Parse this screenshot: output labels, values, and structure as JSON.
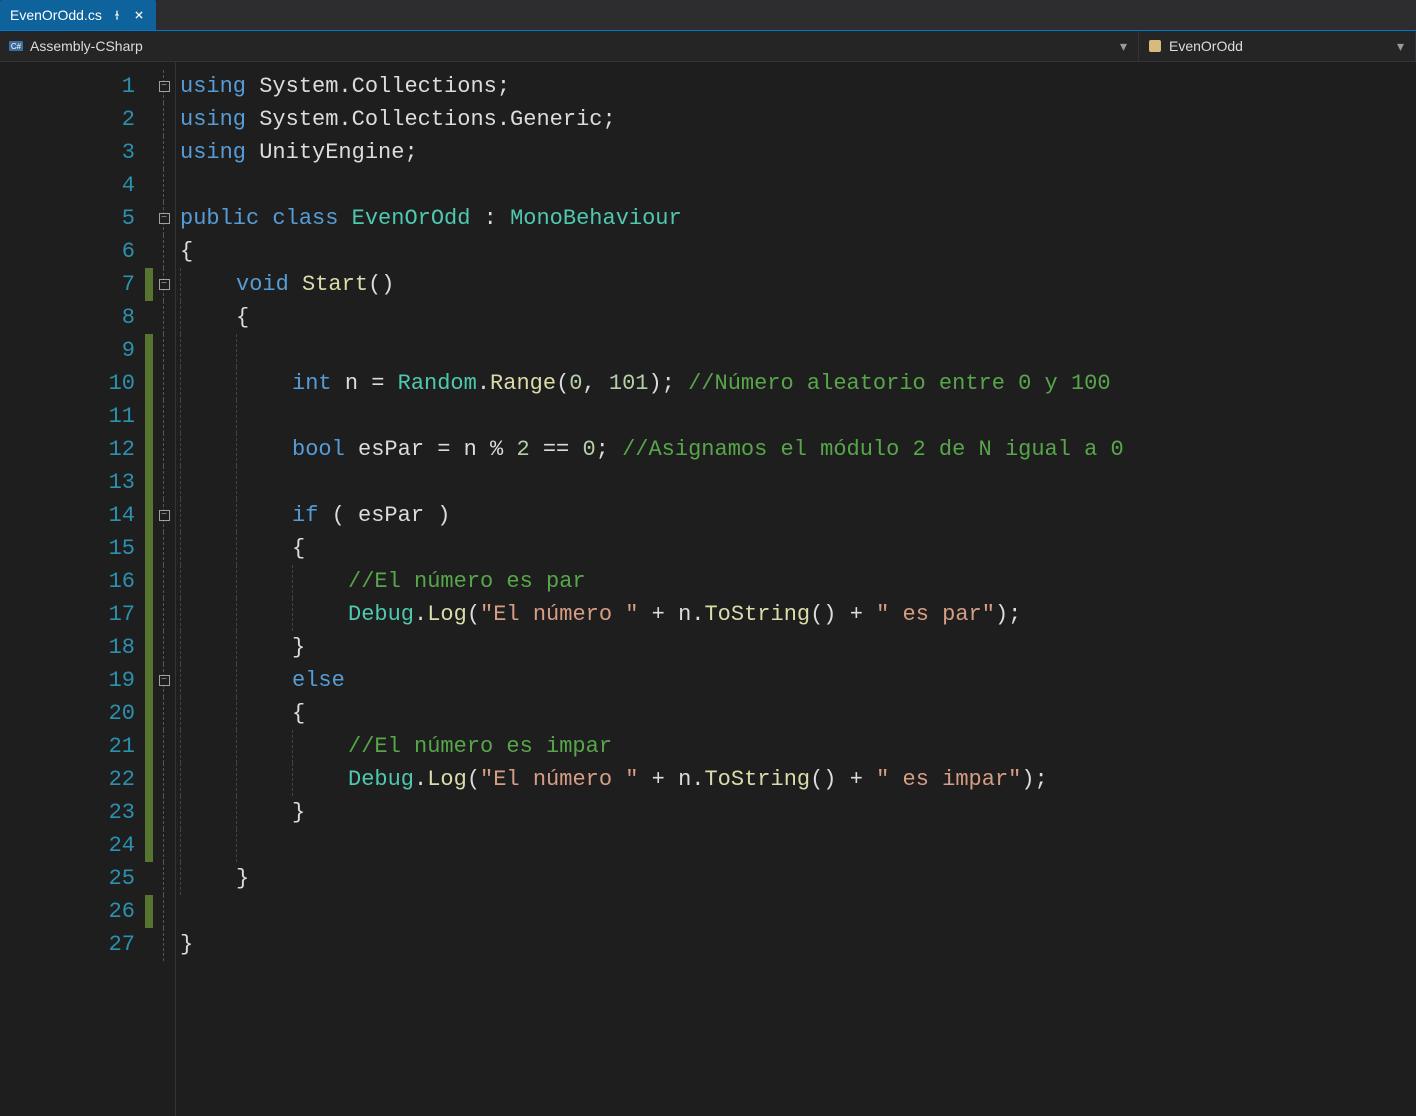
{
  "tab": {
    "filename": "EvenOrOdd.cs",
    "pinned_icon": "pin-icon",
    "close_icon": "close-icon"
  },
  "nav": {
    "project": "Assembly-CSharp",
    "class": "EvenOrOdd"
  },
  "linecount": 27,
  "fold_markers": {
    "1": "box",
    "5": "box",
    "7": "box",
    "14": "box",
    "19": "box"
  },
  "change_lines": [
    7,
    9,
    10,
    11,
    12,
    13,
    14,
    15,
    16,
    17,
    18,
    19,
    20,
    21,
    22,
    23,
    24,
    26
  ],
  "code": {
    "lines": [
      {
        "indent": 0,
        "tokens": [
          [
            "kw",
            "using"
          ],
          [
            "punct",
            " "
          ],
          [
            "ns",
            "System.Collections"
          ],
          [
            "punct",
            ";"
          ]
        ]
      },
      {
        "indent": 0,
        "tokens": [
          [
            "kw",
            "using"
          ],
          [
            "punct",
            " "
          ],
          [
            "ns",
            "System.Collections.Generic"
          ],
          [
            "punct",
            ";"
          ]
        ]
      },
      {
        "indent": 0,
        "tokens": [
          [
            "kw",
            "using"
          ],
          [
            "punct",
            " "
          ],
          [
            "ns",
            "UnityEngine"
          ],
          [
            "punct",
            ";"
          ]
        ]
      },
      {
        "indent": 0,
        "tokens": []
      },
      {
        "indent": 0,
        "tokens": [
          [
            "kw",
            "public"
          ],
          [
            "punct",
            " "
          ],
          [
            "kw",
            "class"
          ],
          [
            "punct",
            " "
          ],
          [
            "cls",
            "EvenOrOdd"
          ],
          [
            "punct",
            " : "
          ],
          [
            "type",
            "MonoBehaviour"
          ]
        ]
      },
      {
        "indent": 0,
        "tokens": [
          [
            "punct",
            "{"
          ]
        ]
      },
      {
        "indent": 1,
        "tokens": [
          [
            "kw",
            "void"
          ],
          [
            "punct",
            " "
          ],
          [
            "method",
            "Start"
          ],
          [
            "punct",
            "()"
          ]
        ]
      },
      {
        "indent": 1,
        "tokens": [
          [
            "punct",
            "{"
          ]
        ]
      },
      {
        "indent": 2,
        "tokens": []
      },
      {
        "indent": 2,
        "tokens": [
          [
            "kw",
            "int"
          ],
          [
            "punct",
            " "
          ],
          [
            "ident",
            "n"
          ],
          [
            "punct",
            " = "
          ],
          [
            "type",
            "Random"
          ],
          [
            "punct",
            "."
          ],
          [
            "method",
            "Range"
          ],
          [
            "punct",
            "("
          ],
          [
            "num",
            "0"
          ],
          [
            "punct",
            ", "
          ],
          [
            "num",
            "101"
          ],
          [
            "punct",
            "); "
          ],
          [
            "comment",
            "//Número aleatorio entre 0 y 100"
          ]
        ]
      },
      {
        "indent": 2,
        "tokens": []
      },
      {
        "indent": 2,
        "tokens": [
          [
            "kw",
            "bool"
          ],
          [
            "punct",
            " "
          ],
          [
            "ident",
            "esPar"
          ],
          [
            "punct",
            " = "
          ],
          [
            "ident",
            "n"
          ],
          [
            "punct",
            " "
          ],
          [
            "op",
            "%"
          ],
          [
            "punct",
            " "
          ],
          [
            "num",
            "2"
          ],
          [
            "punct",
            " "
          ],
          [
            "op",
            "=="
          ],
          [
            "punct",
            " "
          ],
          [
            "num",
            "0"
          ],
          [
            "punct",
            "; "
          ],
          [
            "comment",
            "//Asignamos el módulo 2 de N igual a 0"
          ]
        ]
      },
      {
        "indent": 2,
        "tokens": []
      },
      {
        "indent": 2,
        "tokens": [
          [
            "kw",
            "if"
          ],
          [
            "punct",
            " ( "
          ],
          [
            "ident",
            "esPar"
          ],
          [
            "punct",
            " )"
          ]
        ]
      },
      {
        "indent": 2,
        "tokens": [
          [
            "punct",
            "{"
          ]
        ]
      },
      {
        "indent": 3,
        "tokens": [
          [
            "comment",
            "//El número es par"
          ]
        ]
      },
      {
        "indent": 3,
        "tokens": [
          [
            "type",
            "Debug"
          ],
          [
            "punct",
            "."
          ],
          [
            "method",
            "Log"
          ],
          [
            "punct",
            "("
          ],
          [
            "str",
            "\"El número \""
          ],
          [
            "punct",
            " + "
          ],
          [
            "ident",
            "n"
          ],
          [
            "punct",
            "."
          ],
          [
            "method",
            "ToString"
          ],
          [
            "punct",
            "() + "
          ],
          [
            "str",
            "\" es par\""
          ],
          [
            "punct",
            ");"
          ]
        ]
      },
      {
        "indent": 2,
        "tokens": [
          [
            "punct",
            "}"
          ]
        ]
      },
      {
        "indent": 2,
        "tokens": [
          [
            "kw",
            "else"
          ]
        ]
      },
      {
        "indent": 2,
        "tokens": [
          [
            "punct",
            "{"
          ]
        ]
      },
      {
        "indent": 3,
        "tokens": [
          [
            "comment",
            "//El número es impar"
          ]
        ]
      },
      {
        "indent": 3,
        "tokens": [
          [
            "type",
            "Debug"
          ],
          [
            "punct",
            "."
          ],
          [
            "method",
            "Log"
          ],
          [
            "punct",
            "("
          ],
          [
            "str",
            "\"El número \""
          ],
          [
            "punct",
            " + "
          ],
          [
            "ident",
            "n"
          ],
          [
            "punct",
            "."
          ],
          [
            "method",
            "ToString"
          ],
          [
            "punct",
            "() + "
          ],
          [
            "str",
            "\" es impar\""
          ],
          [
            "punct",
            ");"
          ]
        ]
      },
      {
        "indent": 2,
        "tokens": [
          [
            "punct",
            "}"
          ]
        ]
      },
      {
        "indent": 2,
        "tokens": []
      },
      {
        "indent": 1,
        "tokens": [
          [
            "punct",
            "}"
          ]
        ]
      },
      {
        "indent": 0,
        "tokens": []
      },
      {
        "indent": 0,
        "tokens": [
          [
            "punct",
            "}"
          ]
        ]
      }
    ]
  }
}
